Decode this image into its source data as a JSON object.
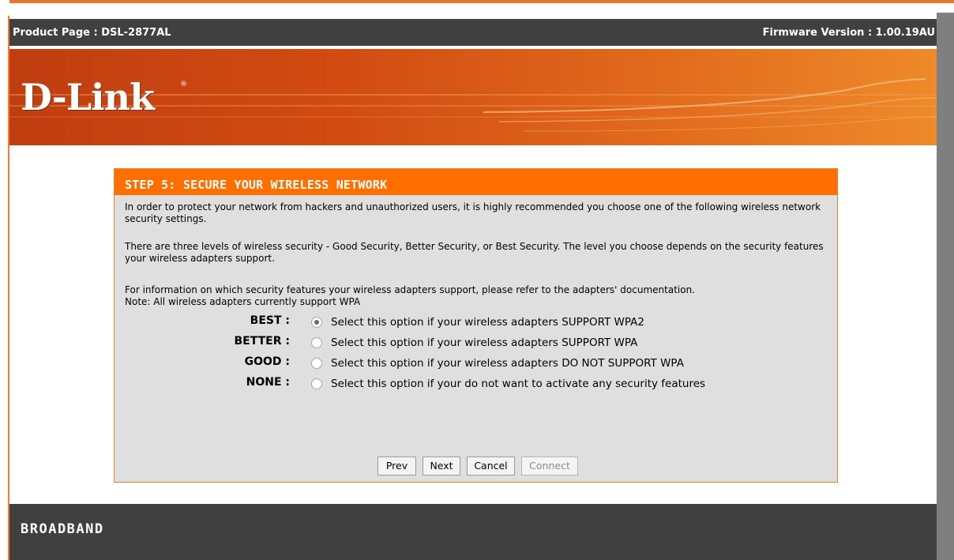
{
  "header": {
    "product": "Product Page : DSL-2877AL",
    "firmware": "Firmware Version : 1.00.19AU"
  },
  "brand": {
    "logo": "D-Link",
    "registered": "®"
  },
  "wizard": {
    "title": "STEP 5: SECURE YOUR WIRELESS NETWORK",
    "paragraph_1": "In order to protect your network from hackers and unauthorized users, it is highly recommended you choose one of the following wireless network security settings.",
    "paragraph_2": "There are three levels of wireless security - Good Security, Better Security, or Best Security. The level you choose depends on the security features your wireless adapters support.",
    "paragraph_3": "For information on which security features your wireless adapters support, please refer to the adapters' documentation.",
    "note": "Note: All wireless adapters currently support WPA",
    "options": [
      {
        "label": "BEST :",
        "text": "Select this option if your wireless adapters SUPPORT WPA2",
        "selected": true
      },
      {
        "label": "BETTER :",
        "text": "Select this option if your wireless adapters SUPPORT WPA",
        "selected": false
      },
      {
        "label": "GOOD :",
        "text": "Select this option if your wireless adapters DO NOT SUPPORT WPA",
        "selected": false
      },
      {
        "label": "NONE :",
        "text": "Select this option if your do not want to activate any security features",
        "selected": false
      }
    ],
    "buttons": {
      "prev": "Prev",
      "next": "Next",
      "cancel": "Cancel",
      "connect": "Connect"
    }
  },
  "footer": {
    "text": "BROADBAND"
  },
  "colors": {
    "accent": "#ff6f00",
    "bar": "#404040",
    "panel": "#dfdfdf"
  }
}
